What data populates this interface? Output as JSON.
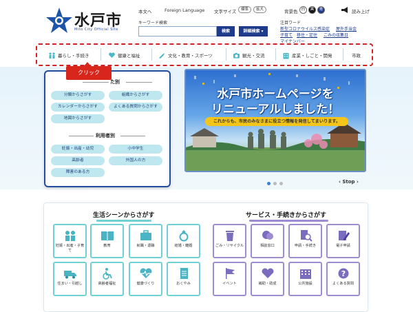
{
  "header": {
    "logo_title": "水戸市",
    "logo_subtitle": "Mito City Official Site",
    "links": {
      "plain_text": "本文へ",
      "foreign_language": "Foreign Language",
      "font_size_label": "文字サイズ",
      "font_standard": "標準",
      "font_large": "拡大",
      "bg_color_label": "背景色",
      "color_white": "白",
      "color_black": "黒",
      "color_blue": "青",
      "read_aloud": "読み上げ"
    },
    "search": {
      "label": "キーワード検索",
      "value": "",
      "placeholder": "",
      "button": "検索",
      "advanced": "詳細検索 ▾"
    },
    "keywords": {
      "title": "注目ワード",
      "items": [
        "新型コロナウイルス感染症",
        "屋外手当金",
        "子育て",
        "移住・定住",
        "ごみの収集日",
        "マイナンバー"
      ]
    }
  },
  "nav": {
    "items": [
      {
        "label": "暮らし・手続き",
        "icon": "family-icon"
      },
      {
        "label": "健康と福祉",
        "icon": "heart-hands-icon"
      },
      {
        "label": "文化・教育・スポーツ",
        "icon": "music-icon"
      },
      {
        "label": "観光・交流",
        "icon": "camera-icon"
      },
      {
        "label": "産業・しごと・開発",
        "icon": "building-icon"
      },
      {
        "label": "市政",
        "icon": ""
      }
    ]
  },
  "callout": {
    "label": "クリック"
  },
  "left_panel": {
    "section1_title": "た別",
    "section1_chips": [
      "分類からさがす",
      "組織からさがす",
      "カレンダーからさがす",
      "よくある質問からさがす",
      "地図からさがす"
    ],
    "section2_title": "利用者別",
    "section2_chips": [
      "妊娠・出産・幼児",
      "小中学生",
      "高齢者",
      "外国人の方",
      "障害のある方"
    ]
  },
  "banner": {
    "title_line1": "水戸市ホームページを",
    "title_line2": "リニューアルしました！",
    "subtitle": "これからも、市民のみなさまに役立つ情報を発信してまいります。"
  },
  "carousel": {
    "stop_label": "Stop"
  },
  "life_section": {
    "title": "生活シーンからさがす",
    "underline_color": "#6fd1d3",
    "tiles": [
      {
        "label": "妊娠・出産・子育て",
        "icon": "family-icon"
      },
      {
        "label": "教育",
        "icon": "book-icon"
      },
      {
        "label": "就職・退職",
        "icon": "briefcase-icon"
      },
      {
        "label": "結婚・離婚",
        "icon": "ring-icon"
      },
      {
        "label": "住まい・引越し",
        "icon": "truck-icon"
      },
      {
        "label": "高齢者福祉",
        "icon": "wheelchair-icon"
      },
      {
        "label": "健康づくり",
        "icon": "heartbeat-icon"
      },
      {
        "label": "おくやみ",
        "icon": "document-icon"
      }
    ]
  },
  "service_section": {
    "title": "サービス・手続きからさがす",
    "underline_color": "#9d8ccf",
    "tiles": [
      {
        "label": "ごみ・リサイクル",
        "icon": "trash-icon"
      },
      {
        "label": "相談窓口",
        "icon": "chat-icon"
      },
      {
        "label": "申請・手続き",
        "icon": "magnifier-doc-icon"
      },
      {
        "label": "電子申請",
        "icon": "pen-icon"
      },
      {
        "label": "イベント",
        "icon": "flag-icon"
      },
      {
        "label": "補助・助成",
        "icon": "handshake-icon"
      },
      {
        "label": "公共施設",
        "icon": "office-icon"
      },
      {
        "label": "よくある質問",
        "icon": "question-icon"
      }
    ]
  },
  "colors": {
    "brand_blue": "#1e3a8a",
    "accent_red": "#d9261c",
    "chip_bg": "#bfe7ef"
  }
}
